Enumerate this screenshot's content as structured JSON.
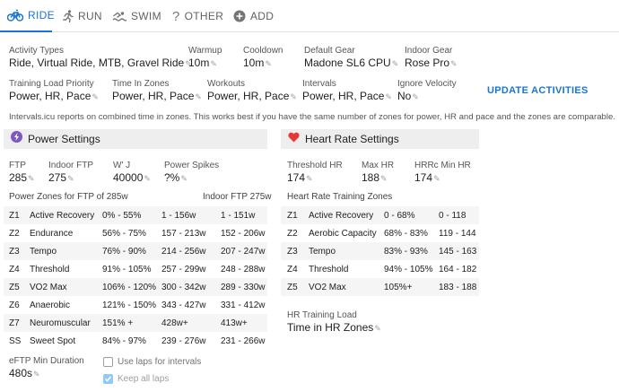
{
  "tabs": [
    {
      "label": "RIDE",
      "icon": "bike-icon",
      "active": true
    },
    {
      "label": "RUN",
      "icon": "run-icon",
      "active": false
    },
    {
      "label": "SWIM",
      "icon": "swim-icon",
      "active": false
    },
    {
      "label": "OTHER",
      "icon": "question-icon",
      "active": false
    },
    {
      "label": "ADD",
      "icon": "add-circle-icon",
      "active": false
    }
  ],
  "fields_row1": [
    {
      "label": "Activity Types",
      "value": "Ride, Virtual Ride, MTB, Gravel Ride"
    },
    {
      "label": "Warmup",
      "value": "10m"
    },
    {
      "label": "Cooldown",
      "value": "10m"
    },
    {
      "label": "Default Gear",
      "value": "Madone SL6 CPU"
    },
    {
      "label": "Indoor Gear",
      "value": "Rose Pro"
    }
  ],
  "fields_row2": [
    {
      "label": "Training Load Priority",
      "value": "Power, HR, Pace"
    },
    {
      "label": "Time In Zones",
      "value": "Power, HR, Pace"
    },
    {
      "label": "Workouts",
      "value": "Power, HR, Pace"
    },
    {
      "label": "Intervals",
      "value": "Power, HR, Pace"
    },
    {
      "label": "Ignore Velocity",
      "value": "No"
    }
  ],
  "update_button": "UPDATE ACTIVITIES",
  "info_text": "Intervals.icu reports on combined time in zones. This works best if you have the same number of zones for power, HR and pace and the zones are comparable.",
  "power": {
    "title": "Power Settings",
    "fields": [
      {
        "label": "FTP",
        "value": "285"
      },
      {
        "label": "Indoor FTP",
        "value": "275"
      },
      {
        "label": "W' J",
        "value": "40000"
      },
      {
        "label": "Power Spikes",
        "value": "?%"
      }
    ],
    "zones_title": "Power Zones for FTP of 285w",
    "zones_indoor_title": "Indoor FTP 275w",
    "zones": [
      {
        "id": "Z1",
        "name": "Active Recovery",
        "pct": "0% - 55%",
        "watts": "1 - 156w",
        "indoor": "1 - 151w"
      },
      {
        "id": "Z2",
        "name": "Endurance",
        "pct": "56% - 75%",
        "watts": "157 - 213w",
        "indoor": "152 - 206w"
      },
      {
        "id": "Z3",
        "name": "Tempo",
        "pct": "76% - 90%",
        "watts": "214 - 256w",
        "indoor": "207 - 247w"
      },
      {
        "id": "Z4",
        "name": "Threshold",
        "pct": "91% - 105%",
        "watts": "257 - 299w",
        "indoor": "248 - 288w"
      },
      {
        "id": "Z5",
        "name": "VO2 Max",
        "pct": "106% - 120%",
        "watts": "300 - 342w",
        "indoor": "289 - 330w"
      },
      {
        "id": "Z6",
        "name": "Anaerobic",
        "pct": "121% - 150%",
        "watts": "343 - 427w",
        "indoor": "331 - 412w"
      },
      {
        "id": "Z7",
        "name": "Neuromuscular",
        "pct": "151% +",
        "watts": "428w+",
        "indoor": "413w+"
      },
      {
        "id": "SS",
        "name": "Sweet Spot",
        "pct": "84% - 97%",
        "watts": "239 - 276w",
        "indoor": "231 - 266w"
      }
    ],
    "eftp_label": "eFTP Min Duration",
    "eftp_value": "480s",
    "laps_label": "Use laps for intervals",
    "keep_laps_label": "Keep all laps"
  },
  "hr": {
    "title": "Heart Rate Settings",
    "fields": [
      {
        "label": "Threshold HR",
        "value": "174"
      },
      {
        "label": "Max HR",
        "value": "188"
      },
      {
        "label": "HRRc Min HR",
        "value": "174"
      }
    ],
    "zones_title": "Heart Rate Training Zones",
    "zones": [
      {
        "id": "Z1",
        "name": "Active Recovery",
        "pct": "0 - 68%",
        "bpm": "0 - 118"
      },
      {
        "id": "Z2",
        "name": "Aerobic Capacity",
        "pct": "68% - 83%",
        "bpm": "119 - 144"
      },
      {
        "id": "Z3",
        "name": "Tempo",
        "pct": "83% - 93%",
        "bpm": "145 - 163"
      },
      {
        "id": "Z4",
        "name": "Threshold",
        "pct": "94% - 105%",
        "bpm": "164 - 182"
      },
      {
        "id": "Z5",
        "name": "VO2 Max",
        "pct": "105%+",
        "bpm": "183 - 188"
      }
    ],
    "load_label": "HR Training Load",
    "load_value": "Time in HR Zones"
  },
  "colors": {
    "accent": "#1976d2",
    "power_icon": "#7e57c2",
    "heart_icon": "#e53935"
  }
}
